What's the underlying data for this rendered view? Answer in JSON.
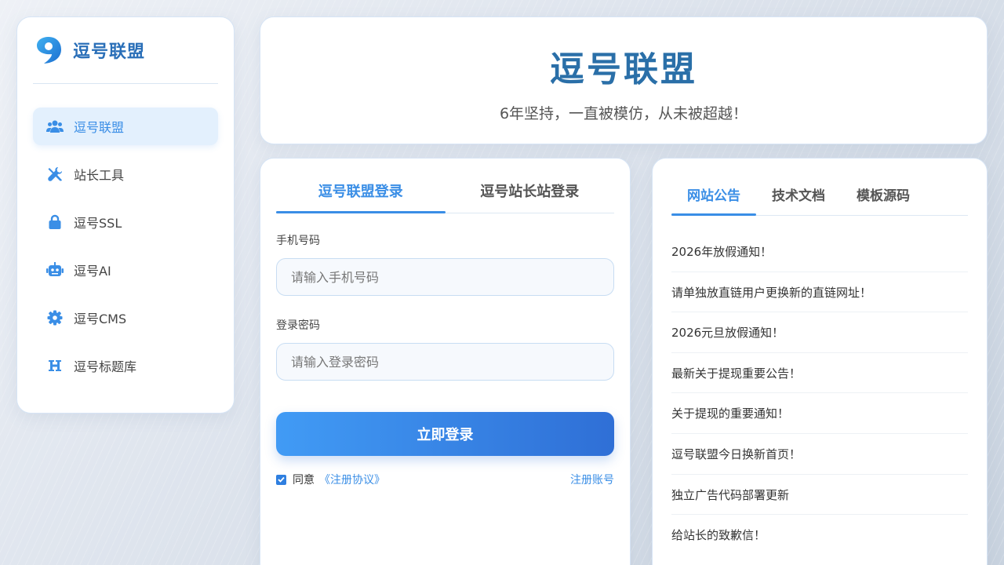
{
  "brand": {
    "name": "逗号联盟"
  },
  "sidebar": {
    "items": [
      {
        "label": "逗号联盟",
        "icon": "users-icon"
      },
      {
        "label": "站长工具",
        "icon": "tools-icon"
      },
      {
        "label": "逗号SSL",
        "icon": "lock-icon"
      },
      {
        "label": "逗号AI",
        "icon": "robot-icon"
      },
      {
        "label": "逗号CMS",
        "icon": "gear-icon"
      },
      {
        "label": "逗号标题库",
        "icon": "heading-icon"
      }
    ]
  },
  "header": {
    "title": "逗号联盟",
    "subtitle": "6年坚持，一直被模仿，从未被超越！"
  },
  "login": {
    "tabs": [
      "逗号联盟登录",
      "逗号站长站登录"
    ],
    "phone_label": "手机号码",
    "phone_placeholder": "请输入手机号码",
    "password_label": "登录密码",
    "password_placeholder": "请输入登录密码",
    "submit_label": "立即登录",
    "agree_text": "同意",
    "agreement_link": "《注册协议》",
    "register_link": "注册账号"
  },
  "notice": {
    "tabs": [
      "网站公告",
      "技术文档",
      "模板源码"
    ],
    "items": [
      "2026年放假通知！",
      "请单独放直链用户更换新的直链网址！",
      "2026元旦放假通知！",
      "最新关于提现重要公告！",
      "关于提现的重要通知！",
      "逗号联盟今日换新首页！",
      "独立广告代码部署更新",
      "给站长的致歉信！"
    ]
  },
  "colors": {
    "accent": "#3a8ee6",
    "brand": "#2a6fa8"
  }
}
